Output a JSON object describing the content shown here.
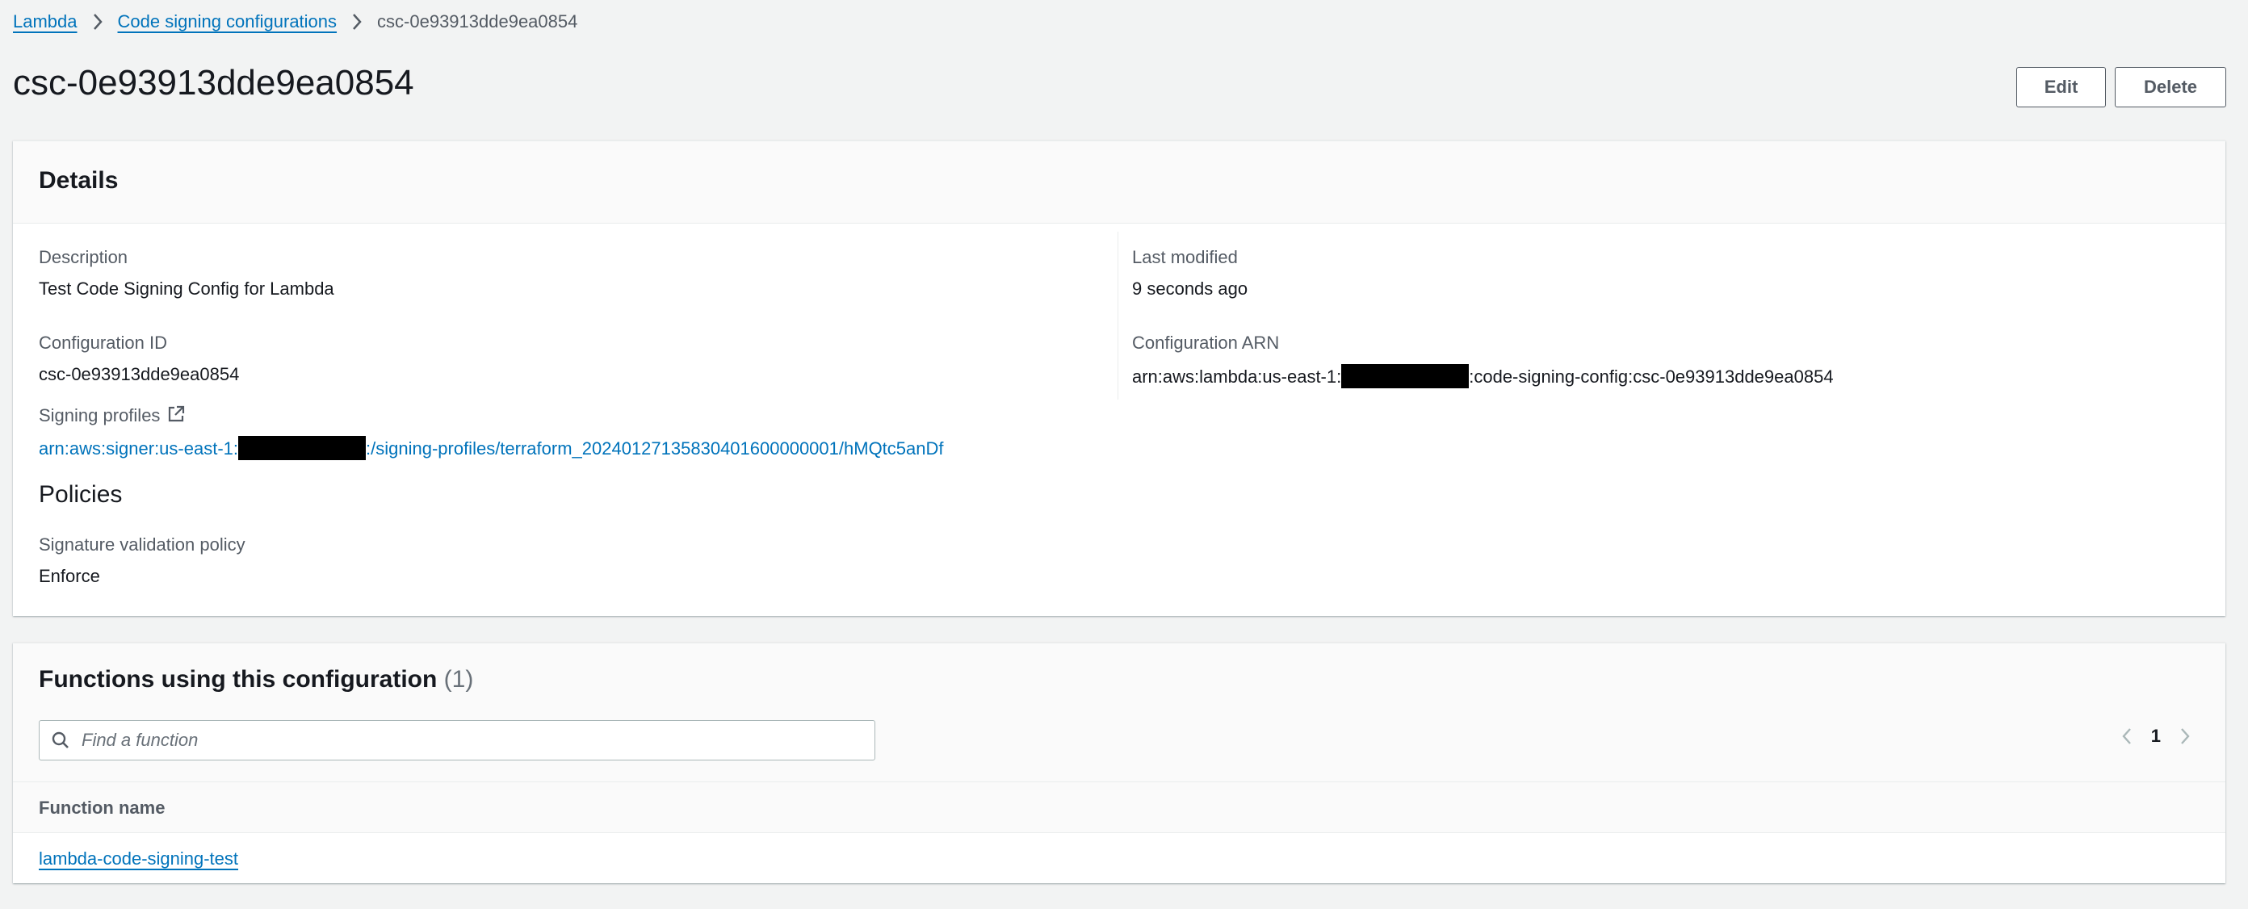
{
  "breadcrumb": {
    "items": [
      "Lambda",
      "Code signing configurations"
    ],
    "current": "csc-0e93913dde9ea0854"
  },
  "page": {
    "title": "csc-0e93913dde9ea0854",
    "edit_label": "Edit",
    "delete_label": "Delete"
  },
  "details": {
    "title": "Details",
    "description": {
      "label": "Description",
      "value": "Test Code Signing Config for Lambda"
    },
    "last_modified": {
      "label": "Last modified",
      "value": "9 seconds ago"
    },
    "configuration_id": {
      "label": "Configuration ID",
      "value": "csc-0e93913dde9ea0854"
    },
    "configuration_arn": {
      "label": "Configuration ARN",
      "prefix": "arn:aws:lambda:us-east-1:",
      "suffix": ":code-signing-config:csc-0e93913dde9ea0854"
    },
    "signing_profiles": {
      "label": "Signing profiles",
      "prefix": "arn:aws:signer:us-east-1:",
      "suffix": ":/signing-profiles/terraform_20240127135830401600000001/hMQtc5anDf"
    },
    "policies": {
      "title": "Policies",
      "signature_validation": {
        "label": "Signature validation policy",
        "value": "Enforce"
      }
    }
  },
  "functions": {
    "title": "Functions using this configuration",
    "count": "(1)",
    "search_placeholder": "Find a function",
    "page": "1",
    "column": "Function name",
    "rows": [
      "lambda-code-signing-test"
    ]
  },
  "colors": {
    "link": "#0073bb",
    "text": "#16191f",
    "secondary": "#545b64",
    "background": "#f2f3f3"
  }
}
